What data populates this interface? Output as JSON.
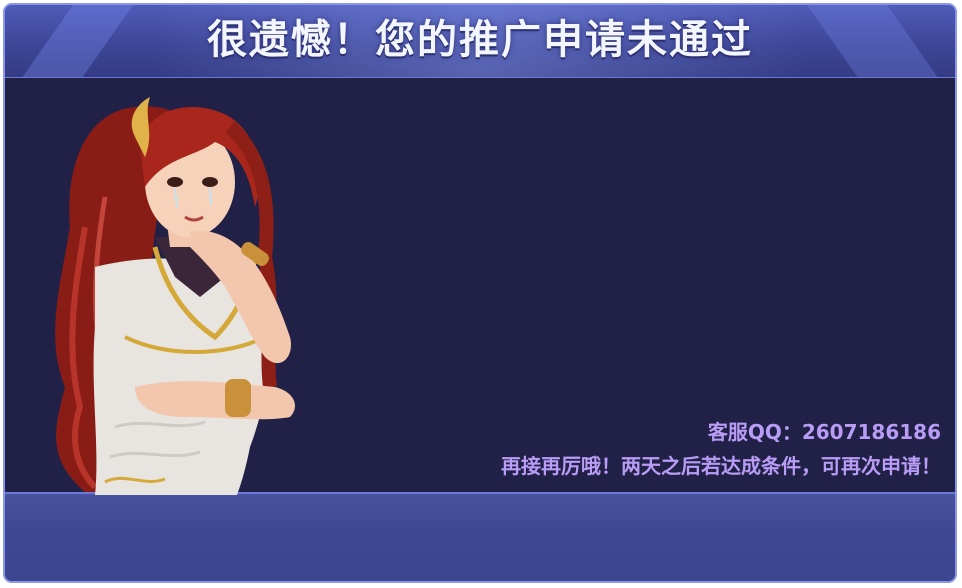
{
  "dialog": {
    "title": "很遗憾！您的推广申请未通过",
    "service_qq": "客服QQ：2607186186",
    "message": "再接再厉哦！两天之后若达成条件，可再次申请！"
  },
  "character": {
    "description_icon": "crying-woman-illustration-icon"
  },
  "colors": {
    "header_bg": "#3d4697",
    "body_bg": "#212147",
    "footer_bg": "#3f4895",
    "info_text": "#b89cf5",
    "border": "#8b96e8"
  }
}
